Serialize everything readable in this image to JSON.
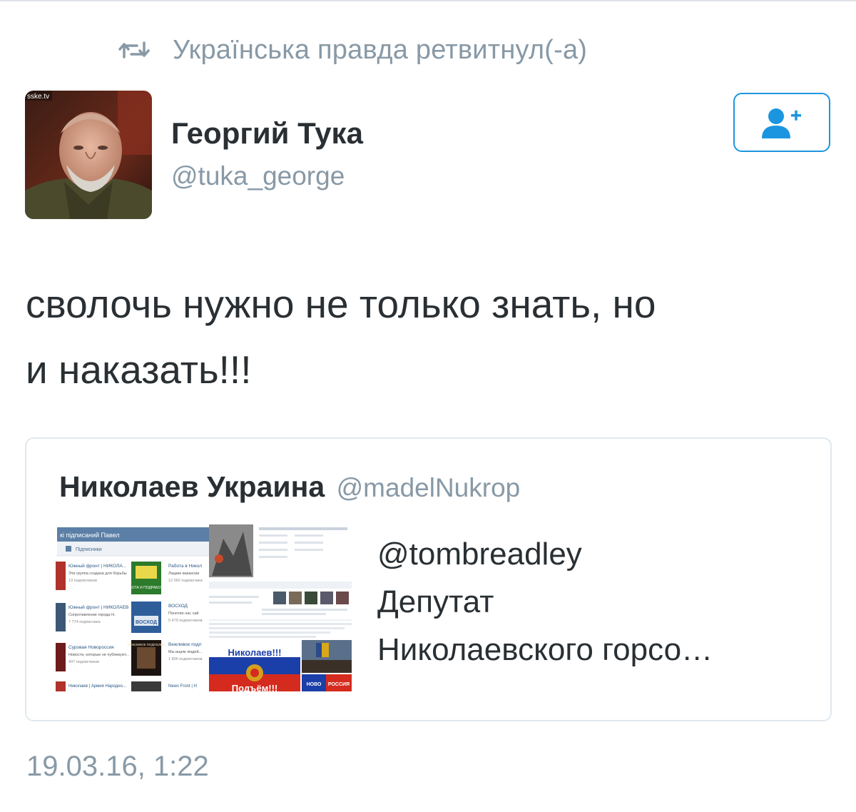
{
  "retweet": {
    "icon": "retweet-icon",
    "text": "Українська правда ретвитнул(-а)"
  },
  "author": {
    "avatar_overlay_text": "sske.tv",
    "name": "Георгий Тука",
    "handle": "@tuka_george"
  },
  "follow_button": {
    "icon": "add-user-icon",
    "color": "#1b95e0"
  },
  "tweet": {
    "line1": "сволочь нужно не только знать, но",
    "line2": "и наказать!!!"
  },
  "quoted_tweet": {
    "name": "Николаев Украина",
    "handle": "@madelNukrop",
    "text_line1": "@tombreadley",
    "text_line2": "Депутат",
    "text_line3": "Николаевского горсо…",
    "media1": {
      "header": "кі підписаний Павел",
      "subheader": "Підписники",
      "rows": [
        {
          "title": "Южный фронт | НИКОЛА...",
          "line2": "Эта группа создана для борьбы",
          "line3": "13 подписчиков"
        },
        {
          "title": "Южный фронт | НИКОЛАЕВ",
          "line2": "Сопротивление города Н.",
          "line3": "7 774 подписчика"
        },
        {
          "title": "Суровая Новороссия",
          "line2": "Новости, которые не публикуют...",
          "line3": "437 подписчиков"
        },
        {
          "title": "Николаев | Армия Народно...",
          "line2": "",
          "line3": ""
        }
      ],
      "right_rows": [
        {
          "title": "Работа в Никол",
          "line2": "Лацкие вакансии",
          "line3": "12 062 подписчика"
        },
        {
          "title": "ВОСХОД",
          "line2": "Понятие нас сай",
          "line3": "5 479 подписчиков"
        },
        {
          "title": "Вежливое подп",
          "line2": "Мы ищем людей...",
          "line3": "1 836 подписчиков"
        },
        {
          "title": "News Front | Н",
          "line2": "",
          "line3": ""
        }
      ],
      "thumb_label_work": "РАБОТА И ПОДРАБОТКИ",
      "thumb_label_voskhod": "ВОСХОД",
      "thumb_label_polite": "ВЕЖЛИВОЕ ПОДПОЛЬЕ"
    },
    "media2": {
      "poster_title": "Николаев!!!",
      "poster_bottom": "Подъём!!!",
      "badge_left": "НОВО",
      "badge_right": "РОССИЯ"
    }
  },
  "timestamp": "19.03.16, 1:22"
}
